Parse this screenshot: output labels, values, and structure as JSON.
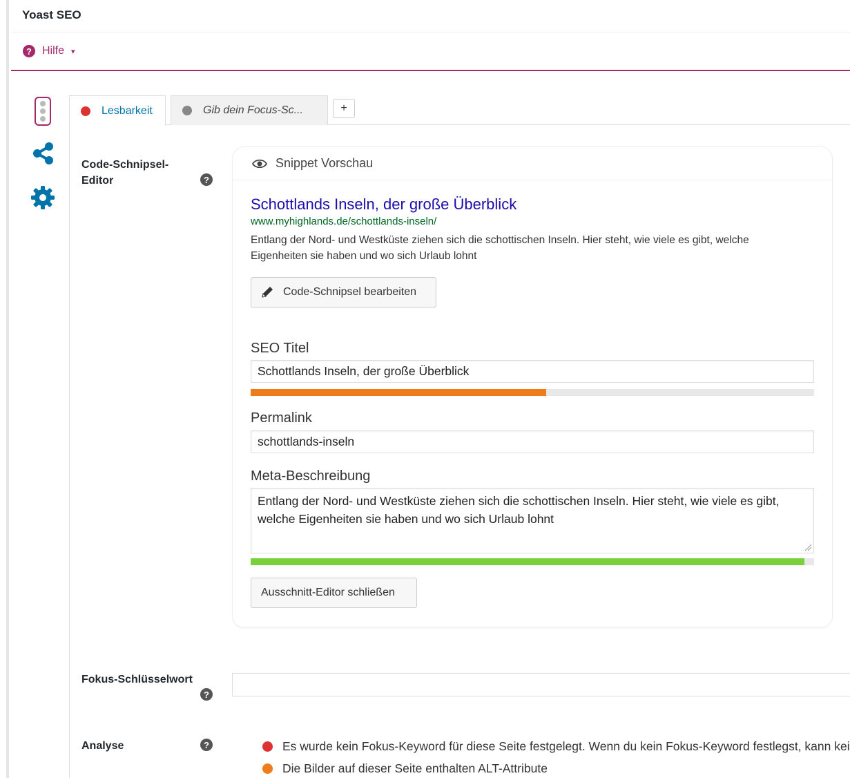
{
  "header": {
    "title": "Yoast SEO"
  },
  "help": {
    "label": "Hilfe",
    "caret": "▾"
  },
  "tabs": {
    "readability": {
      "label": "Lesbarkeit",
      "dot_color": "#dc3232"
    },
    "keyword": {
      "label": "Gib dein Focus-Sc...",
      "dot_color": "#888888"
    },
    "add": "+"
  },
  "snippet_editor": {
    "label": "Code-Schnipsel-Editor",
    "label_line1": "Code-Schnipsel-",
    "label_line2": "Editor",
    "preview_heading": "Snippet Vorschau",
    "serp": {
      "title": "Schottlands Inseln, der große Überblick",
      "url": "www.myhighlands.de/schottlands-inseln/",
      "description": "Entlang der Nord- und Westküste ziehen sich die schottischen Inseln. Hier steht, wie viele es gibt, welche Eigenheiten sie haben und wo sich Urlaub lohnt"
    },
    "edit_button": "Code-Schnipsel bearbeiten",
    "seo_title": {
      "label": "SEO Titel",
      "value": "Schottlands Inseln, der große Überblick",
      "progress": 0.525,
      "progress_color": "#ee7c1b"
    },
    "permalink": {
      "label": "Permalink",
      "value": "schottlands-inseln"
    },
    "meta_description": {
      "label": "Meta-Beschreibung",
      "value": "Entlang der Nord- und Westküste ziehen sich die schottischen Inseln. Hier steht, wie viele es gibt, welche Eigenheiten sie haben und wo sich Urlaub lohnt",
      "progress": 0.983,
      "progress_color": "#7ad03a"
    },
    "close_button": "Ausschnitt-Editor schließen"
  },
  "focus_keyword": {
    "label": "Fokus-Schlüsselwort",
    "value": ""
  },
  "analysis": {
    "label": "Analyse",
    "items": [
      {
        "text": "Es wurde kein Fokus-Keyword für diese Seite festgelegt. Wenn du kein Fokus-Keyword festlegst, kann keine Bewertung vorgenommen werden.",
        "color": "#dc3232"
      },
      {
        "text": "Die Bilder auf dieser Seite enthalten ALT-Attribute",
        "color": "#ee7c1b"
      }
    ]
  },
  "colors": {
    "brand": "#a4286a",
    "link": "#0073aa"
  },
  "icons": {
    "help": "question-circle-icon",
    "traffic_light": "traffic-light-icon",
    "share": "share-icon",
    "settings": "gear-icon",
    "preview": "eye-icon",
    "edit": "pencil-icon"
  }
}
